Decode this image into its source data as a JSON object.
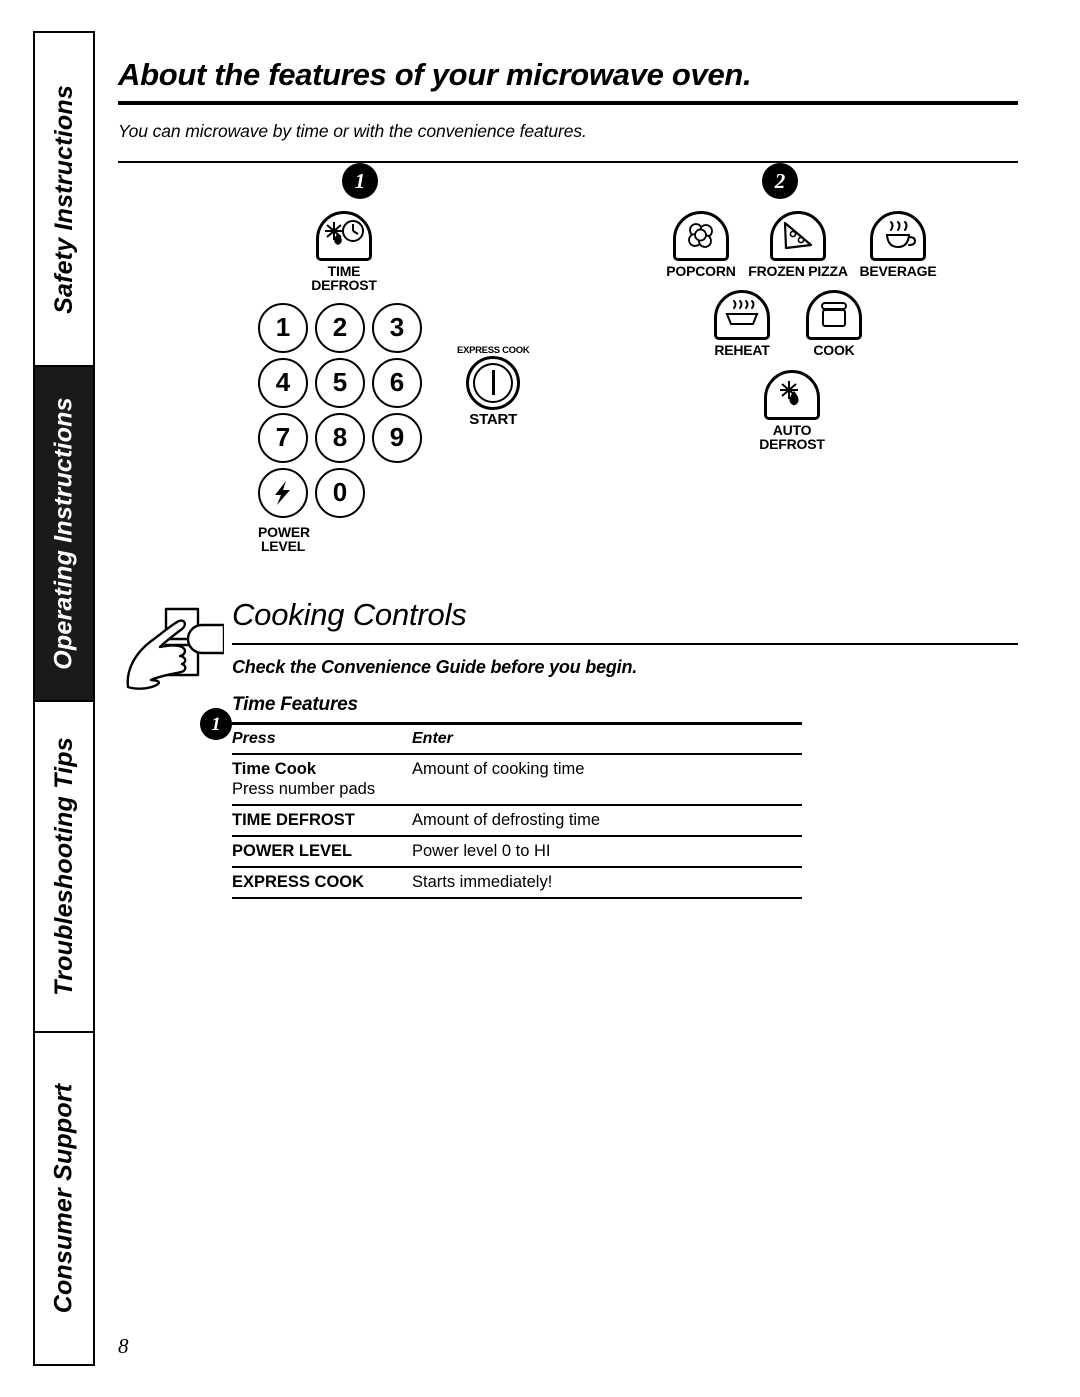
{
  "sidebar": {
    "tabs": [
      {
        "label": "Safety Instructions",
        "style": "light"
      },
      {
        "label": "Operating Instructions",
        "style": "dark"
      },
      {
        "label": "Troubleshooting Tips",
        "style": "light"
      },
      {
        "label": "Consumer Support",
        "style": "light"
      }
    ]
  },
  "header": {
    "title": "About the features of your microwave oven.",
    "intro": "You can microwave by time or with the convenience features."
  },
  "panels": {
    "step_one_badge": "1",
    "step_two_badge": "2",
    "keypad": {
      "time_defrost_label_line1": "TIME",
      "time_defrost_label_line2": "DEFROST",
      "keys": [
        "1",
        "2",
        "3",
        "4",
        "5",
        "6",
        "7",
        "8",
        "9"
      ],
      "zero_key": "0",
      "power_level_label_line1": "POWER",
      "power_level_label_line2": "LEVEL",
      "express_cook_label": "EXPRESS COOK",
      "start_label": "START"
    },
    "convenience": {
      "row1": [
        {
          "label": "POPCORN",
          "icon": "popcorn-icon"
        },
        {
          "label": "FROZEN PIZZA",
          "icon": "pizza-slice-icon"
        },
        {
          "label": "BEVERAGE",
          "icon": "beverage-cup-icon"
        }
      ],
      "row2": [
        {
          "label": "REHEAT",
          "icon": "reheat-dish-icon"
        },
        {
          "label": "COOK",
          "icon": "cook-pot-icon"
        }
      ],
      "row3": [
        {
          "label_line1": "AUTO",
          "label_line2": "DEFROST",
          "icon": "auto-defrost-icon"
        }
      ]
    }
  },
  "cooking_controls": {
    "title": "Cooking Controls",
    "subtitle": "Check the Convenience Guide before you begin.",
    "hand_icon": "pointing-hand-icon"
  },
  "time_features": {
    "badge": "1",
    "title": "Time Features",
    "columns": [
      "Press",
      "Enter"
    ],
    "rows": [
      {
        "press": "Time Cook",
        "press_sub": "Press number pads",
        "enter": "Amount of cooking time",
        "press_bold": true
      },
      {
        "press": "TIME DEFROST",
        "enter": "Amount of defrosting time",
        "press_bold": true
      },
      {
        "press": "POWER LEVEL",
        "enter": "Power level 0 to HI",
        "press_bold": true
      },
      {
        "press": "EXPRESS COOK",
        "enter": "Starts immediately!",
        "press_bold": true
      }
    ]
  },
  "footer": {
    "page_number": "8"
  },
  "colors": {
    "ink": "#000000",
    "paper": "#ffffff",
    "dark_tab": "#1a1a1a"
  }
}
